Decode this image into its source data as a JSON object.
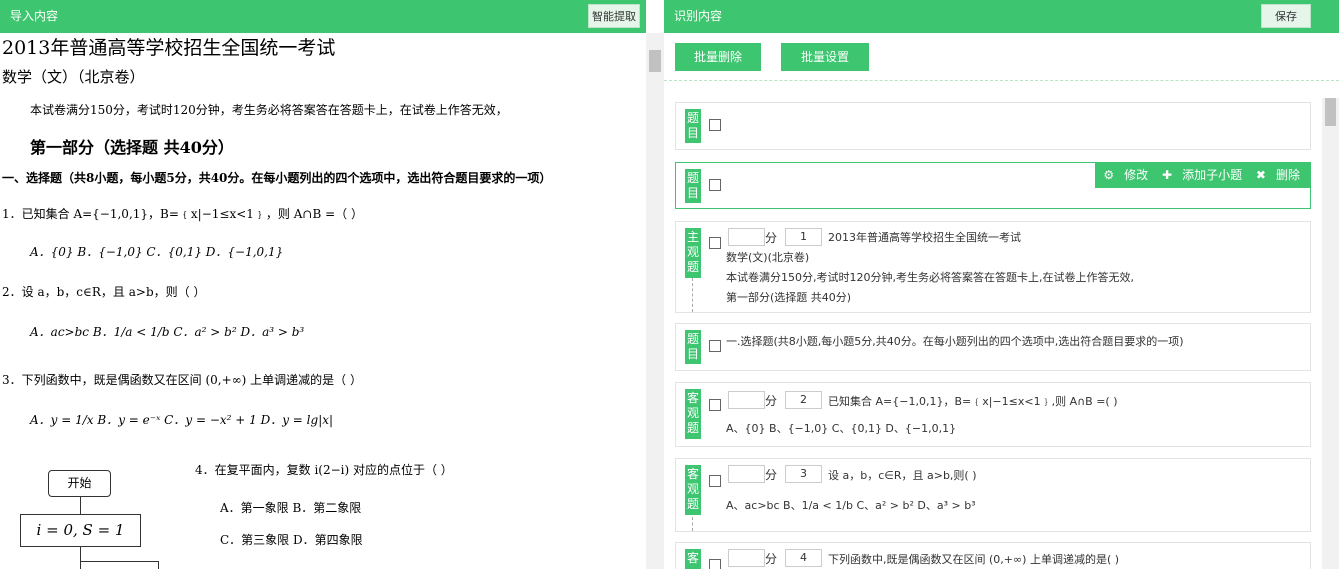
{
  "left_panel": {
    "title": "导入内容",
    "smart_extract_label": "智能提取",
    "doc": {
      "title": "2013年普通高等学校招生全国统一考试",
      "subtitle": "数学（文）（北京卷）",
      "note": "本试卷满分150分，考试时120分钟，考生务必将答案答在答题卡上，在试卷上作答无效，",
      "part": "第一部分（选择题 共40分）",
      "section": "一、选择题（共8小题，每小题5分，共40分。在每小题列出的四个选项中，选出符合题目要求的一项）",
      "q1": "1．已知集合 A={−1,0,1}，B=﹛x|−1≤x<1﹜，则 A∩B =（ ）",
      "q1_options": "A．{0}  B．{−1,0}  C．{0,1}  D．{−1,0,1}",
      "q2": "2．设 a，b，c∈R，且 a>b，则（ ）",
      "q2_options": "A．ac>bc  B．1/a < 1/b  C．a² > b²  D．a³ > b³",
      "q3": "3．下列函数中，既是偶函数又在区间 (0,+∞) 上单调递减的是（ ）",
      "q3_options": "A．y = 1/x  B．y = e⁻ˣ  C．y = −x² + 1  D．y = lg|x|",
      "q4": "4．在复平面内，复数 i(2−i) 对应的点位于（ ）",
      "q4_options_1": "A．第一象限 B．第二象限",
      "q4_options_2": "C．第三象限 D．第四象限",
      "flow_start": "开始",
      "flow_box": "i = 0, S = 1"
    }
  },
  "right_panel": {
    "title": "识别内容",
    "save_label": "保存",
    "batch_delete_label": "批量删除",
    "batch_set_label": "批量设置",
    "card_actions": {
      "edit": "修改",
      "add_sub": "添加子小题",
      "delete": "删除"
    },
    "score_unit": "分",
    "cards": [
      {
        "tag": "题目"
      },
      {
        "tag": "题目"
      },
      {
        "tag": "主观题",
        "number": "1",
        "lines": [
          "2013年普通高等学校招生全国统一考试",
          "数学(文)(北京卷)",
          "本试卷满分150分,考试时120分钟,考生务必将答案答在答题卡上,在试卷上作答无效,",
          "第一部分(选择题 共40分)"
        ]
      },
      {
        "tag": "题目",
        "text": "一.选择题(共8小题,每小题5分,共40分。在每小题列出的四个选项中,选出符合题目要求的一项)"
      },
      {
        "tag": "客观题",
        "number": "2",
        "line1": "已知集合 A={−1,0,1}，B=﹛x|−1≤x<1﹜,则 A∩B =( )",
        "line2": "A、{0}  B、{−1,0}  C、{0,1}  D、{−1,0,1}"
      },
      {
        "tag": "客观题",
        "number": "3",
        "line1": "设 a，b，c∈R，且 a>b,则( )",
        "line2": "A、ac>bc  B、1/a < 1/b  C、a² > b²  D、a³ > b³"
      },
      {
        "tag": "客",
        "number": "4",
        "line1": "下列函数中,既是偶函数又在区间 (0,+∞) 上单调递减的是( )"
      }
    ]
  },
  "colors": {
    "accent": "#3dc56f",
    "accent_light": "#e6f5ea"
  }
}
